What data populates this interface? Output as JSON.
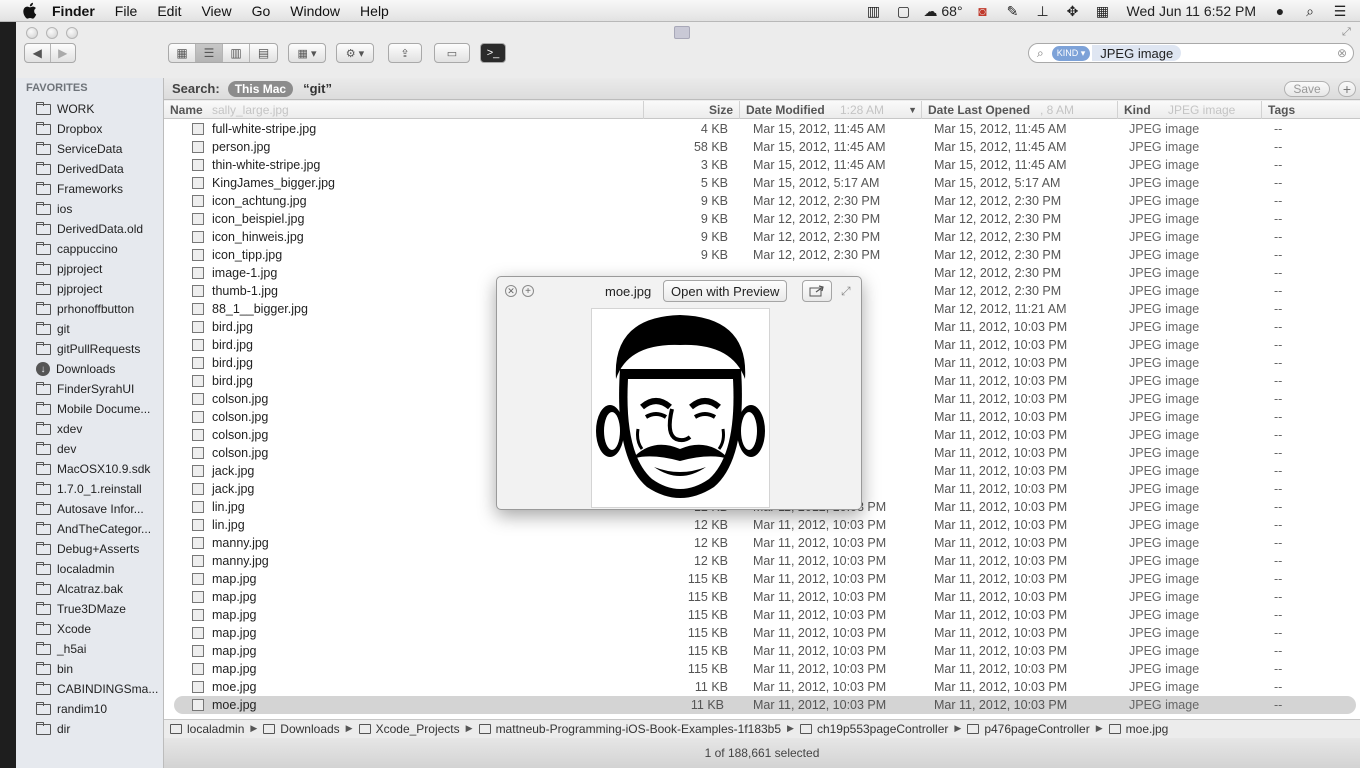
{
  "menubar": {
    "app_name": "Finder",
    "items": [
      "File",
      "Edit",
      "View",
      "Go",
      "Window",
      "Help"
    ],
    "weather": "68°",
    "clock": "Wed Jun 11  6:52 PM"
  },
  "toolbar": {
    "search_token_kind": "KIND ▾",
    "search_token_value": "JPEG image"
  },
  "scopebar": {
    "label": "Search:",
    "scope_active": "This Mac",
    "scope_other": "“git”",
    "save_label": "Save",
    "add_label": "+"
  },
  "sidebar": {
    "heading": "FAVORITES",
    "items": [
      "WORK",
      "Dropbox",
      "ServiceData",
      "DerivedData",
      "Frameworks",
      "ios",
      "DerivedData.old",
      "cappuccino",
      "pjproject",
      "pjproject",
      "prhonoffbutton",
      "git",
      "gitPullRequests",
      "Downloads",
      "FinderSyrahUI",
      "Mobile Docume...",
      "xdev",
      "dev",
      "MacOSX10.9.sdk",
      "1.7.0_1.reinstall",
      "Autosave Infor...",
      "AndTheCategor...",
      "Debug+Asserts",
      "localadmin",
      "Alcatraz.bak",
      "True3DMaze",
      "Xcode",
      "_h5ai",
      "bin",
      "CABINDINGSma...",
      "randim10",
      "dir"
    ]
  },
  "columns": {
    "name": "Name",
    "size": "Size",
    "modified": "Date Modified",
    "opened": "Date Last Opened",
    "kind": "Kind",
    "tags": "Tags",
    "ghost_name": "sally_large.jpg",
    "ghost_mod": "1:28 AM",
    "ghost_open": ", 8 AM",
    "ghost_kind": "JPEG image"
  },
  "rows": [
    {
      "name": "full-white-stripe.jpg",
      "size": "4 KB",
      "mod": "Mar 15, 2012, 11:45 AM",
      "open": "Mar 15, 2012, 11:45 AM",
      "kind": "JPEG image",
      "tags": "--"
    },
    {
      "name": "person.jpg",
      "size": "58 KB",
      "mod": "Mar 15, 2012, 11:45 AM",
      "open": "Mar 15, 2012, 11:45 AM",
      "kind": "JPEG image",
      "tags": "--"
    },
    {
      "name": "thin-white-stripe.jpg",
      "size": "3 KB",
      "mod": "Mar 15, 2012, 11:45 AM",
      "open": "Mar 15, 2012, 11:45 AM",
      "kind": "JPEG image",
      "tags": "--"
    },
    {
      "name": "KingJames_bigger.jpg",
      "size": "5 KB",
      "mod": "Mar 15, 2012, 5:17 AM",
      "open": "Mar 15, 2012, 5:17 AM",
      "kind": "JPEG image",
      "tags": "--"
    },
    {
      "name": "icon_achtung.jpg",
      "size": "9 KB",
      "mod": "Mar 12, 2012, 2:30 PM",
      "open": "Mar 12, 2012, 2:30 PM",
      "kind": "JPEG image",
      "tags": "--"
    },
    {
      "name": "icon_beispiel.jpg",
      "size": "9 KB",
      "mod": "Mar 12, 2012, 2:30 PM",
      "open": "Mar 12, 2012, 2:30 PM",
      "kind": "JPEG image",
      "tags": "--"
    },
    {
      "name": "icon_hinweis.jpg",
      "size": "9 KB",
      "mod": "Mar 12, 2012, 2:30 PM",
      "open": "Mar 12, 2012, 2:30 PM",
      "kind": "JPEG image",
      "tags": "--"
    },
    {
      "name": "icon_tipp.jpg",
      "size": "9 KB",
      "mod": "Mar 12, 2012, 2:30 PM",
      "open": "Mar 12, 2012, 2:30 PM",
      "kind": "JPEG image",
      "tags": "--"
    },
    {
      "name": "image-1.jpg",
      "size": "",
      "mod": "",
      "open": "Mar 12, 2012, 2:30 PM",
      "kind": "JPEG image",
      "tags": "--"
    },
    {
      "name": "thumb-1.jpg",
      "size": "",
      "mod": "",
      "open": "Mar 12, 2012, 2:30 PM",
      "kind": "JPEG image",
      "tags": "--"
    },
    {
      "name": "88_1__bigger.jpg",
      "size": "",
      "mod": "",
      "open": "Mar 12, 2012, 11:21 AM",
      "kind": "JPEG image",
      "tags": "--"
    },
    {
      "name": "bird.jpg",
      "size": "",
      "mod": "",
      "open": "Mar 11, 2012, 10:03 PM",
      "kind": "JPEG image",
      "tags": "--"
    },
    {
      "name": "bird.jpg",
      "size": "",
      "mod": "",
      "open": "Mar 11, 2012, 10:03 PM",
      "kind": "JPEG image",
      "tags": "--"
    },
    {
      "name": "bird.jpg",
      "size": "",
      "mod": "",
      "open": "Mar 11, 2012, 10:03 PM",
      "kind": "JPEG image",
      "tags": "--"
    },
    {
      "name": "bird.jpg",
      "size": "",
      "mod": "",
      "open": "Mar 11, 2012, 10:03 PM",
      "kind": "JPEG image",
      "tags": "--"
    },
    {
      "name": "colson.jpg",
      "size": "",
      "mod": "",
      "open": "Mar 11, 2012, 10:03 PM",
      "kind": "JPEG image",
      "tags": "--"
    },
    {
      "name": "colson.jpg",
      "size": "",
      "mod": "",
      "open": "Mar 11, 2012, 10:03 PM",
      "kind": "JPEG image",
      "tags": "--"
    },
    {
      "name": "colson.jpg",
      "size": "",
      "mod": "",
      "open": "Mar 11, 2012, 10:03 PM",
      "kind": "JPEG image",
      "tags": "--"
    },
    {
      "name": "colson.jpg",
      "size": "",
      "mod": "",
      "open": "Mar 11, 2012, 10:03 PM",
      "kind": "JPEG image",
      "tags": "--"
    },
    {
      "name": "jack.jpg",
      "size": "",
      "mod": "",
      "open": "Mar 11, 2012, 10:03 PM",
      "kind": "JPEG image",
      "tags": "--"
    },
    {
      "name": "jack.jpg",
      "size": "",
      "mod": "",
      "open": "Mar 11, 2012, 10:03 PM",
      "kind": "JPEG image",
      "tags": "--"
    },
    {
      "name": "lin.jpg",
      "size": "12 KB",
      "mod": "Mar 11, 2012, 10:03 PM",
      "open": "Mar 11, 2012, 10:03 PM",
      "kind": "JPEG image",
      "tags": "--"
    },
    {
      "name": "lin.jpg",
      "size": "12 KB",
      "mod": "Mar 11, 2012, 10:03 PM",
      "open": "Mar 11, 2012, 10:03 PM",
      "kind": "JPEG image",
      "tags": "--"
    },
    {
      "name": "manny.jpg",
      "size": "12 KB",
      "mod": "Mar 11, 2012, 10:03 PM",
      "open": "Mar 11, 2012, 10:03 PM",
      "kind": "JPEG image",
      "tags": "--"
    },
    {
      "name": "manny.jpg",
      "size": "12 KB",
      "mod": "Mar 11, 2012, 10:03 PM",
      "open": "Mar 11, 2012, 10:03 PM",
      "kind": "JPEG image",
      "tags": "--"
    },
    {
      "name": "map.jpg",
      "size": "115 KB",
      "mod": "Mar 11, 2012, 10:03 PM",
      "open": "Mar 11, 2012, 10:03 PM",
      "kind": "JPEG image",
      "tags": "--"
    },
    {
      "name": "map.jpg",
      "size": "115 KB",
      "mod": "Mar 11, 2012, 10:03 PM",
      "open": "Mar 11, 2012, 10:03 PM",
      "kind": "JPEG image",
      "tags": "--"
    },
    {
      "name": "map.jpg",
      "size": "115 KB",
      "mod": "Mar 11, 2012, 10:03 PM",
      "open": "Mar 11, 2012, 10:03 PM",
      "kind": "JPEG image",
      "tags": "--"
    },
    {
      "name": "map.jpg",
      "size": "115 KB",
      "mod": "Mar 11, 2012, 10:03 PM",
      "open": "Mar 11, 2012, 10:03 PM",
      "kind": "JPEG image",
      "tags": "--"
    },
    {
      "name": "map.jpg",
      "size": "115 KB",
      "mod": "Mar 11, 2012, 10:03 PM",
      "open": "Mar 11, 2012, 10:03 PM",
      "kind": "JPEG image",
      "tags": "--"
    },
    {
      "name": "map.jpg",
      "size": "115 KB",
      "mod": "Mar 11, 2012, 10:03 PM",
      "open": "Mar 11, 2012, 10:03 PM",
      "kind": "JPEG image",
      "tags": "--"
    },
    {
      "name": "moe.jpg",
      "size": "11 KB",
      "mod": "Mar 11, 2012, 10:03 PM",
      "open": "Mar 11, 2012, 10:03 PM",
      "kind": "JPEG image",
      "tags": "--"
    },
    {
      "name": "moe.jpg",
      "size": "11 KB",
      "mod": "Mar 11, 2012, 10:03 PM",
      "open": "Mar 11, 2012, 10:03 PM",
      "kind": "JPEG image",
      "tags": "--",
      "selected": true
    }
  ],
  "pathbar": [
    "localadmin",
    "Downloads",
    "Xcode_Projects",
    "mattneub-Programming-iOS-Book-Examples-1f183b5",
    "ch19p553pageController",
    "p476pageController",
    "moe.jpg"
  ],
  "status": "1 of 188,661 selected",
  "quicklook": {
    "title": "moe.jpg",
    "open_label": "Open with Preview"
  }
}
